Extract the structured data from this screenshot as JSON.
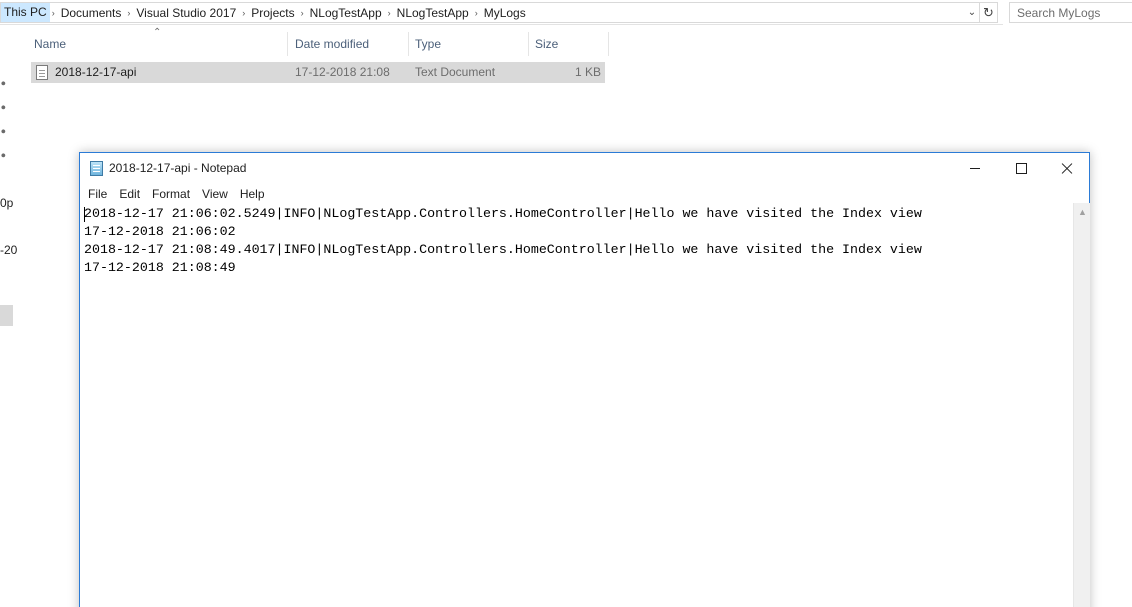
{
  "explorer": {
    "breadcrumbs": [
      "This PC",
      "Documents",
      "Visual Studio 2017",
      "Projects",
      "NLogTestApp",
      "NLogTestApp",
      "MyLogs"
    ],
    "search_placeholder": "Search MyLogs",
    "nav_fragments": [
      "0p",
      "-20"
    ],
    "columns": [
      "Name",
      "Date modified",
      "Type",
      "Size"
    ],
    "files": [
      {
        "name": "2018-12-17-api",
        "date_modified": "17-12-2018 21:08",
        "type": "Text Document",
        "size": "1 KB"
      }
    ]
  },
  "notepad": {
    "title": "2018-12-17-api - Notepad",
    "menu": [
      "File",
      "Edit",
      "Format",
      "View",
      "Help"
    ],
    "lines": [
      "2018-12-17 21:06:02.5249|INFO|NLogTestApp.Controllers.HomeController|Hello we have visited the Index view",
      "17-12-2018 21:06:02",
      "2018-12-17 21:08:49.4017|INFO|NLogTestApp.Controllers.HomeController|Hello we have visited the Index view",
      "17-12-2018 21:08:49"
    ]
  },
  "colors": {
    "selection_blue": "#cce8ff",
    "row_selected": "#d9d9d9",
    "header_text": "#4c607a",
    "window_border": "#2b7bd6"
  }
}
